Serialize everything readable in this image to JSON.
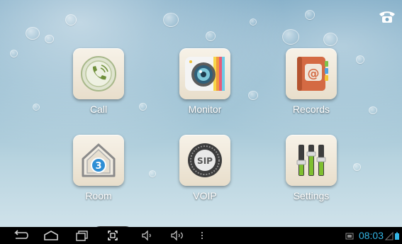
{
  "apps": [
    {
      "id": "call",
      "label": "Call",
      "icon": "phone-icon"
    },
    {
      "id": "monitor",
      "label": "Monitor",
      "icon": "camera-icon"
    },
    {
      "id": "records",
      "label": "Records",
      "icon": "address-book-icon"
    },
    {
      "id": "room",
      "label": "Room",
      "icon": "house-icon",
      "badge": "3"
    },
    {
      "id": "voip",
      "label": "VOIP",
      "icon": "sip-icon",
      "badge": "SIP"
    },
    {
      "id": "settings",
      "label": "Settings",
      "icon": "sliders-icon"
    }
  ],
  "status_bar": {
    "time": "08:03"
  },
  "nav_bar": {
    "buttons": [
      "back-icon",
      "home-icon",
      "recent-apps-icon",
      "screenshot-icon",
      "volume-down-icon",
      "volume-up-icon",
      "menu-dots-icon"
    ]
  },
  "top_right": {
    "icon": "telephone-icon"
  },
  "colors": {
    "accent": "#33b5e5",
    "label": "#ffffff",
    "navbar": "#000000"
  }
}
